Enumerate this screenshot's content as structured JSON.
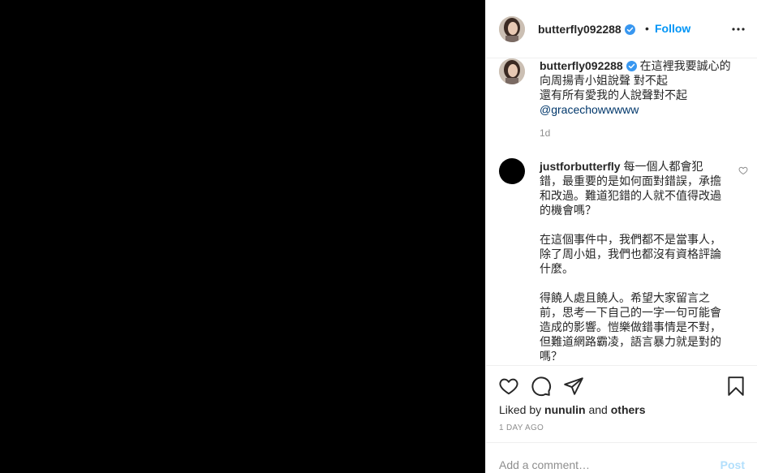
{
  "header": {
    "username": "butterfly092288",
    "dot": "•",
    "follow_label": "Follow",
    "more_icon": "more-horizontal-icon"
  },
  "caption": {
    "username": "butterfly092288",
    "text": " 在這裡我要誠心的\n向周揚青小姐說聲 對不起\n還有所有愛我的人說聲對不起\n",
    "mention": "@gracechowwwww",
    "time": "1d"
  },
  "comment": {
    "username": "justforbutterfly",
    "text": " 每一個人都會犯\n錯，最重要的是如何面對錯誤，承擔\n和改過。難道犯錯的人就不值得改過\n的機會嗎？\n\n在這個事件中，我們都不是當事人，\n除了周小姐，我們也都沒有資格評論\n什麼。\n\n得饒人處且饒人。希望大家留言之\n前，思考一下自己的一字一句可能會\n造成的影響。愷樂做錯事情是不對，\n但難道網路霸凌，語言暴力就是對的\n嗎？"
  },
  "actions": {
    "liked_by_prefix": "Liked by ",
    "liked_by_user": "nunulin",
    "liked_by_suffix_and": " and ",
    "liked_by_others": "others",
    "post_time": "1 DAY AGO"
  },
  "add_comment": {
    "placeholder": "Add a comment…",
    "post_label": "Post"
  },
  "colors": {
    "accent": "#0095f6",
    "post_disabled": "#b2dffc",
    "mention": "#00376b",
    "muted": "#8e8e8e"
  }
}
